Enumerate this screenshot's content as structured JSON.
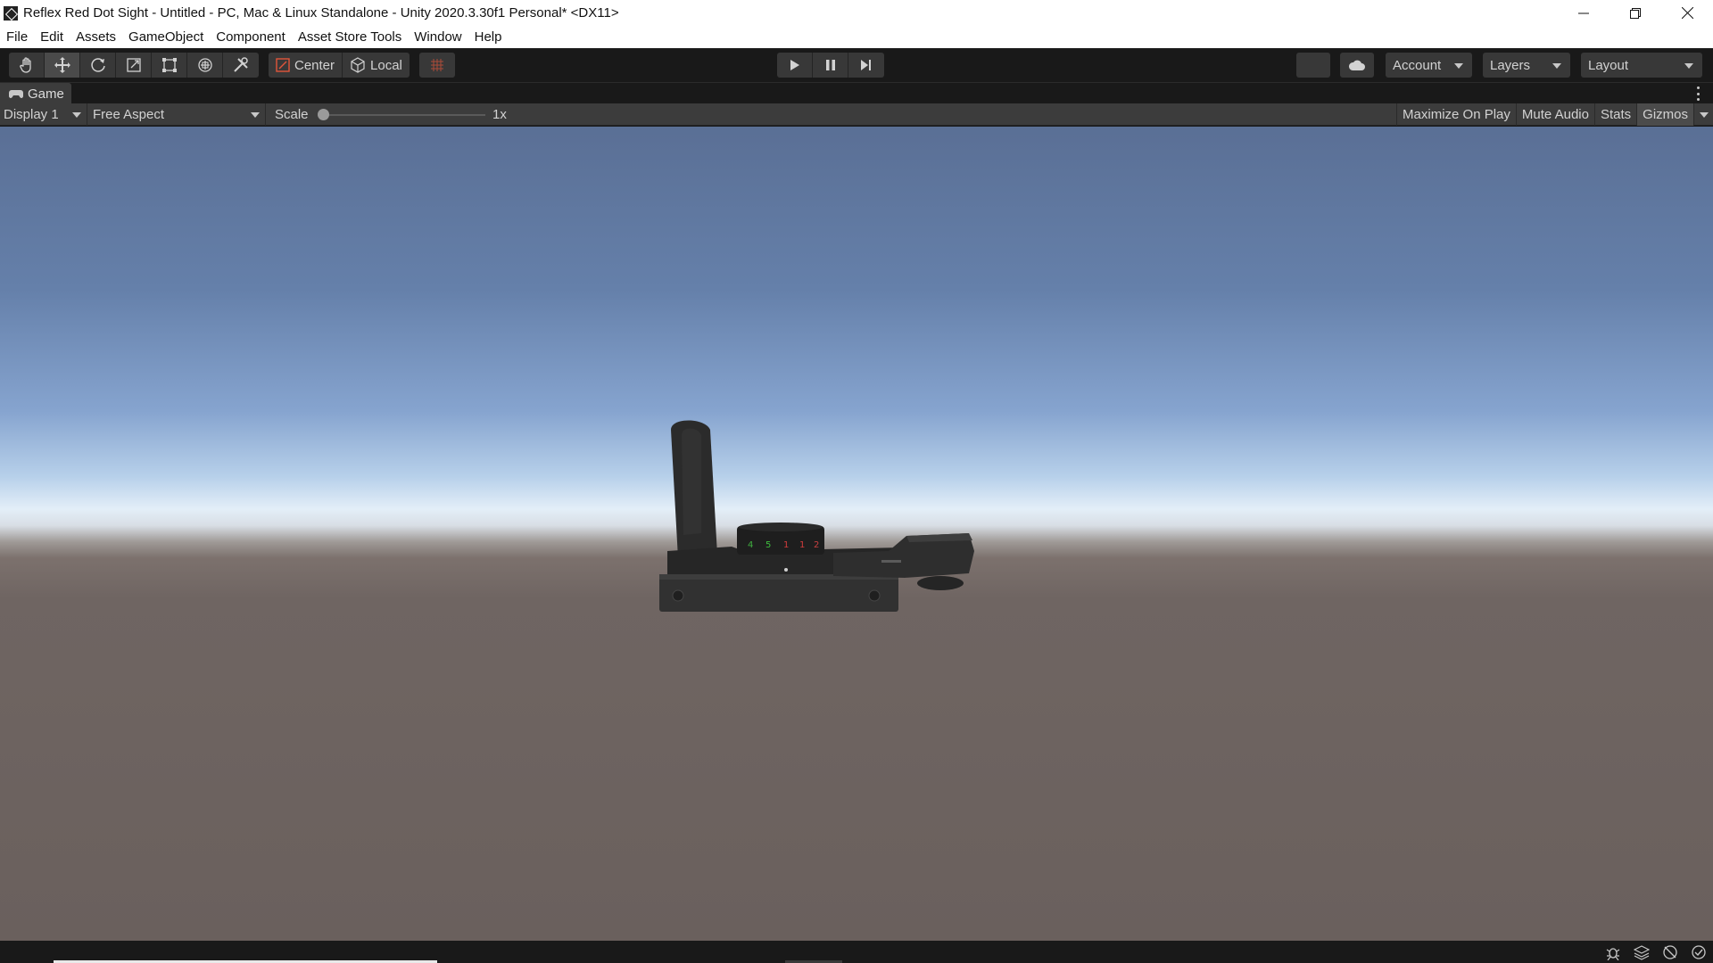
{
  "window": {
    "title": "Reflex Red Dot Sight - Untitled - PC, Mac & Linux Standalone - Unity 2020.3.30f1 Personal* <DX11>",
    "controls": [
      "minimize",
      "restore",
      "close"
    ]
  },
  "menu": {
    "items": [
      "File",
      "Edit",
      "Assets",
      "GameObject",
      "Component",
      "Asset Store Tools",
      "Window",
      "Help"
    ]
  },
  "toolbar": {
    "tools": [
      {
        "name": "hand-tool",
        "icon": "hand-icon"
      },
      {
        "name": "move-tool",
        "icon": "move-arrows-icon",
        "active": true
      },
      {
        "name": "rotate-tool",
        "icon": "rotate-icon"
      },
      {
        "name": "scale-tool",
        "icon": "scale-icon"
      },
      {
        "name": "rect-tool",
        "icon": "rect-icon"
      },
      {
        "name": "transform-tool",
        "icon": "transform-icon"
      },
      {
        "name": "custom-tool",
        "icon": "tools-icon"
      }
    ],
    "pivot_mode": "Center",
    "pivot_rotation": "Local",
    "account_label": "Account",
    "layers_label": "Layers",
    "layout_label": "Layout"
  },
  "game_tab": {
    "label": "Game"
  },
  "game_view": {
    "display": "Display 1",
    "aspect": "Free Aspect",
    "scale_label": "Scale",
    "scale_value": "1x",
    "scale_fraction": 0.0,
    "buttons": [
      "Maximize On Play",
      "Mute Audio",
      "Stats",
      "Gizmos"
    ]
  },
  "scene": {
    "dial_numbers": [
      "4",
      "5",
      "1",
      "1",
      "2"
    ],
    "dial_colors": [
      "#3fae3f",
      "#3fbf3f",
      "#d23c3c",
      "#d23c3c",
      "#c84040"
    ]
  },
  "colors": {
    "accent": "#3a72b0",
    "sky_top": "#5a6f95",
    "horizon": "#e3eef8",
    "ground": "#6a605d"
  }
}
